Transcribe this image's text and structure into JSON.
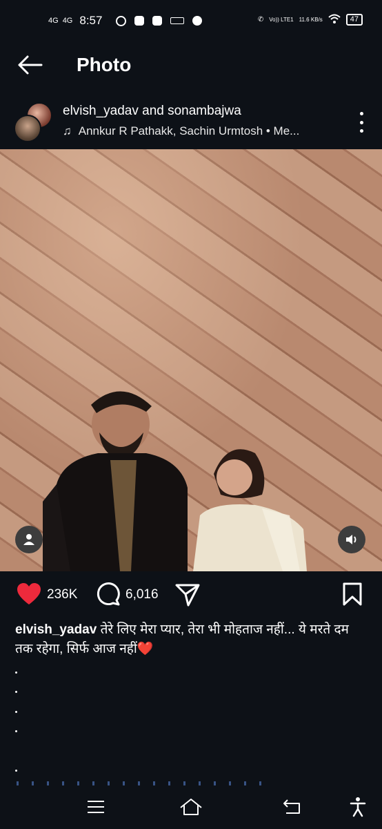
{
  "status_bar": {
    "signal1": "4G",
    "signal2": "4G",
    "time": "8:57",
    "volte": "Vo)) LTE1",
    "net_speed": "11.6 KB/s",
    "battery": "47"
  },
  "header": {
    "title": "Photo"
  },
  "post": {
    "author1": "elvish_yadav",
    "and_text": "and",
    "author2": "sonambajwa",
    "music": "Annkur R Pathakk, Sachin Urmtosh • Me..."
  },
  "actions": {
    "likes": "236K",
    "comments": "6,016"
  },
  "caption": {
    "username": "elvish_yadav",
    "text": "तेरे लिए मेरा प्यार, तेरा भी मोहताज नहीं... ये मरते दम तक रहेगा, सिर्फ आज नहीं",
    "emoji": "❤️"
  },
  "colors": {
    "background": "#0d1117",
    "heart": "#ed2a3c"
  }
}
